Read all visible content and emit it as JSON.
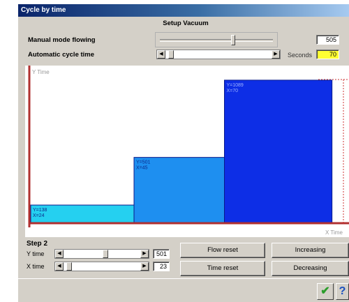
{
  "window": {
    "title": "Cycle by time"
  },
  "header": {
    "section_title": "Setup Vacuum"
  },
  "manual": {
    "label": "Manual mode flowing",
    "value": "505"
  },
  "automatic": {
    "label": "Automatic cycle time",
    "unit_label": "Seconds",
    "value": "70"
  },
  "chart": {
    "ylabel": "Y Time",
    "xlabel": "X Time",
    "axis_color": "#b03030",
    "colors": [
      "#25d0f0",
      "#1e8ff0",
      "#0d2ee6"
    ]
  },
  "chart_data": {
    "type": "bar",
    "xlabel": "X Time",
    "ylabel": "Y Time",
    "bars": [
      {
        "x_start": 0,
        "x_end": 24,
        "y": 138,
        "label_y": "Y=138",
        "label_x": "X=24"
      },
      {
        "x_start": 24,
        "x_end": 45,
        "y": 501,
        "label_y": "Y=501",
        "label_x": "X=45"
      },
      {
        "x_start": 45,
        "x_end": 70,
        "y": 1089,
        "label_y": "Y=1089",
        "label_x": "X=70"
      }
    ],
    "xlim": [
      0,
      72
    ],
    "ylim": [
      0,
      1200
    ],
    "grid": false
  },
  "step": {
    "title": "Step 2",
    "y_label": "Y time",
    "y_value": "501",
    "x_label": "X time",
    "x_value": "23"
  },
  "buttons": {
    "flow_reset": "Flow reset",
    "time_reset": "Time reset",
    "increasing": "Increasing",
    "decreasing": "Decreasing"
  }
}
